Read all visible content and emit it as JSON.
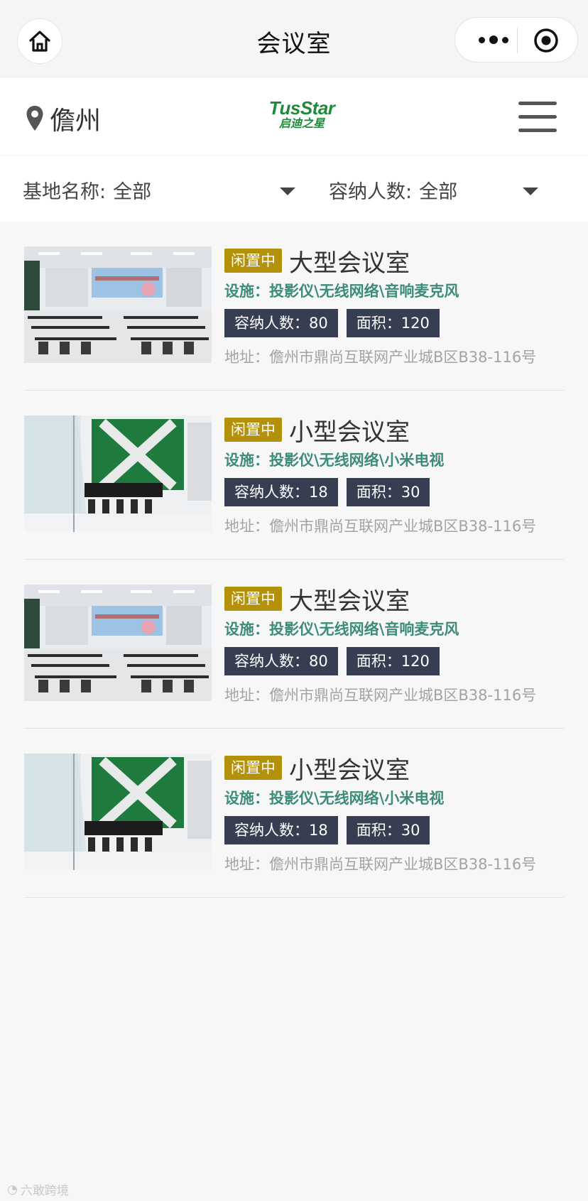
{
  "titlebar": {
    "title": "会议室"
  },
  "header": {
    "city": "儋州",
    "logo_main": "TusStar",
    "logo_sub": "启迪之星"
  },
  "filters": [
    {
      "label": "基地名称:",
      "value": "全部"
    },
    {
      "label": "容纳人数:",
      "value": "全部"
    }
  ],
  "rooms": [
    {
      "status": "闲置中",
      "name": "大型会议室",
      "facilities": "设施：投影仪\\无线网络\\音响麦克风",
      "capacity": "容纳人数：80",
      "area": "面积：120",
      "address": "地址：儋州市鼎尚互联网产业城B区B38-116号",
      "photo": "large-conference-room-photo"
    },
    {
      "status": "闲置中",
      "name": "小型会议室",
      "facilities": "设施：投影仪\\无线网络\\小米电视",
      "capacity": "容纳人数：18",
      "area": "面积：30",
      "address": "地址：儋州市鼎尚互联网产业城B区B38-116号",
      "photo": "small-meeting-room-photo"
    },
    {
      "status": "闲置中",
      "name": "大型会议室",
      "facilities": "设施：投影仪\\无线网络\\音响麦克风",
      "capacity": "容纳人数：80",
      "area": "面积：120",
      "address": "地址：儋州市鼎尚互联网产业城B区B38-116号",
      "photo": "large-conference-room-photo"
    },
    {
      "status": "闲置中",
      "name": "小型会议室",
      "facilities": "设施：投影仪\\无线网络\\小米电视",
      "capacity": "容纳人数：18",
      "area": "面积：30",
      "address": "地址：儋州市鼎尚互联网产业城B区B38-116号",
      "photo": "small-meeting-room-photo"
    }
  ],
  "watermark": "六敢跨境",
  "colors": {
    "status_badge": "#b4910b",
    "facility_text": "#3d8c7a",
    "tag_bg": "#383e52",
    "brand_green": "#1e8a3a"
  }
}
